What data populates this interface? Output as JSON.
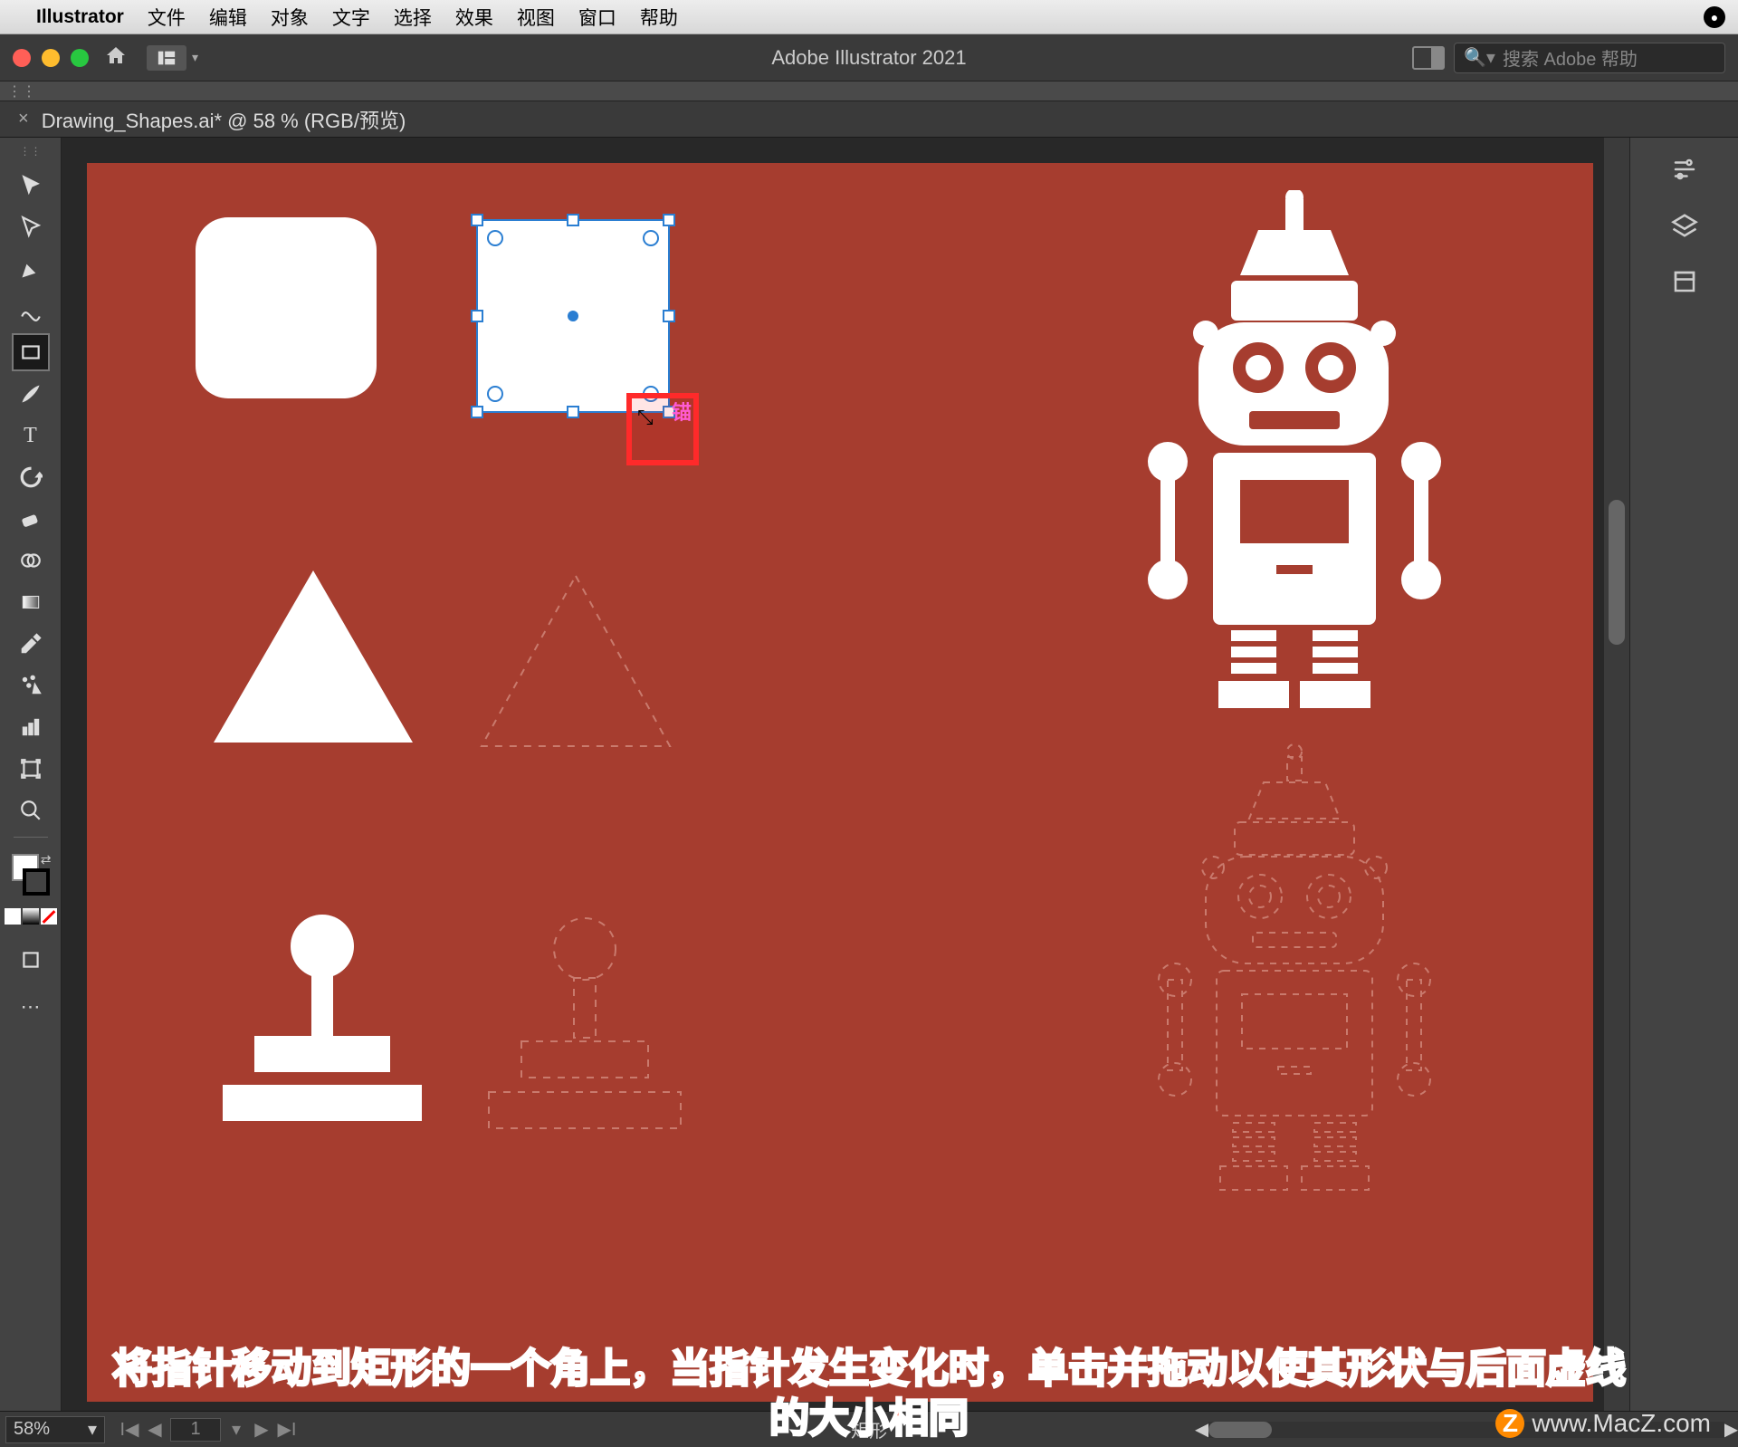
{
  "menubar": {
    "app": "Illustrator",
    "items": [
      "文件",
      "编辑",
      "对象",
      "文字",
      "选择",
      "效果",
      "视图",
      "窗口",
      "帮助"
    ]
  },
  "window": {
    "title": "Adobe Illustrator 2021",
    "search_placeholder": "搜索 Adobe 帮助"
  },
  "tab": {
    "title": "Drawing_Shapes.ai* @ 58 % (RGB/预览)"
  },
  "status": {
    "zoom": "58%",
    "artboard": "1",
    "shape_name": "矩形"
  },
  "tools": [
    {
      "name": "selection-tool",
      "glyph": "▲"
    },
    {
      "name": "direct-selection-tool",
      "glyph": "▲"
    },
    {
      "name": "pen-tool",
      "glyph": "✒"
    },
    {
      "name": "curvature-tool",
      "glyph": "〰"
    },
    {
      "name": "rectangle-tool",
      "glyph": "▭",
      "active": true
    },
    {
      "name": "paintbrush-tool",
      "glyph": "🖌"
    },
    {
      "name": "type-tool",
      "glyph": "T"
    },
    {
      "name": "rotate-tool",
      "glyph": "⟳"
    },
    {
      "name": "eraser-tool",
      "glyph": "◧"
    },
    {
      "name": "shape-builder-tool",
      "glyph": "◔"
    },
    {
      "name": "gradient-tool",
      "glyph": "▥"
    },
    {
      "name": "eyedropper-tool",
      "glyph": "✎"
    },
    {
      "name": "symbol-sprayer-tool",
      "glyph": "✲"
    },
    {
      "name": "column-graph-tool",
      "glyph": "▤"
    },
    {
      "name": "artboard-tool",
      "glyph": "▢"
    },
    {
      "name": "zoom-tool",
      "glyph": "🔍"
    }
  ],
  "right_panel_icons": [
    {
      "name": "properties-icon"
    },
    {
      "name": "layers-icon"
    },
    {
      "name": "libraries-icon"
    }
  ],
  "canvas": {
    "bg_color": "#a63d2f",
    "selection_label": "锚"
  },
  "annotation": {
    "line1": "将指针移动到矩形的一个角上，当指针发生变化时，单击并拖动以使其形状与后面虚线",
    "line2": "的大小相同"
  },
  "watermark": "www.MacZ.com"
}
